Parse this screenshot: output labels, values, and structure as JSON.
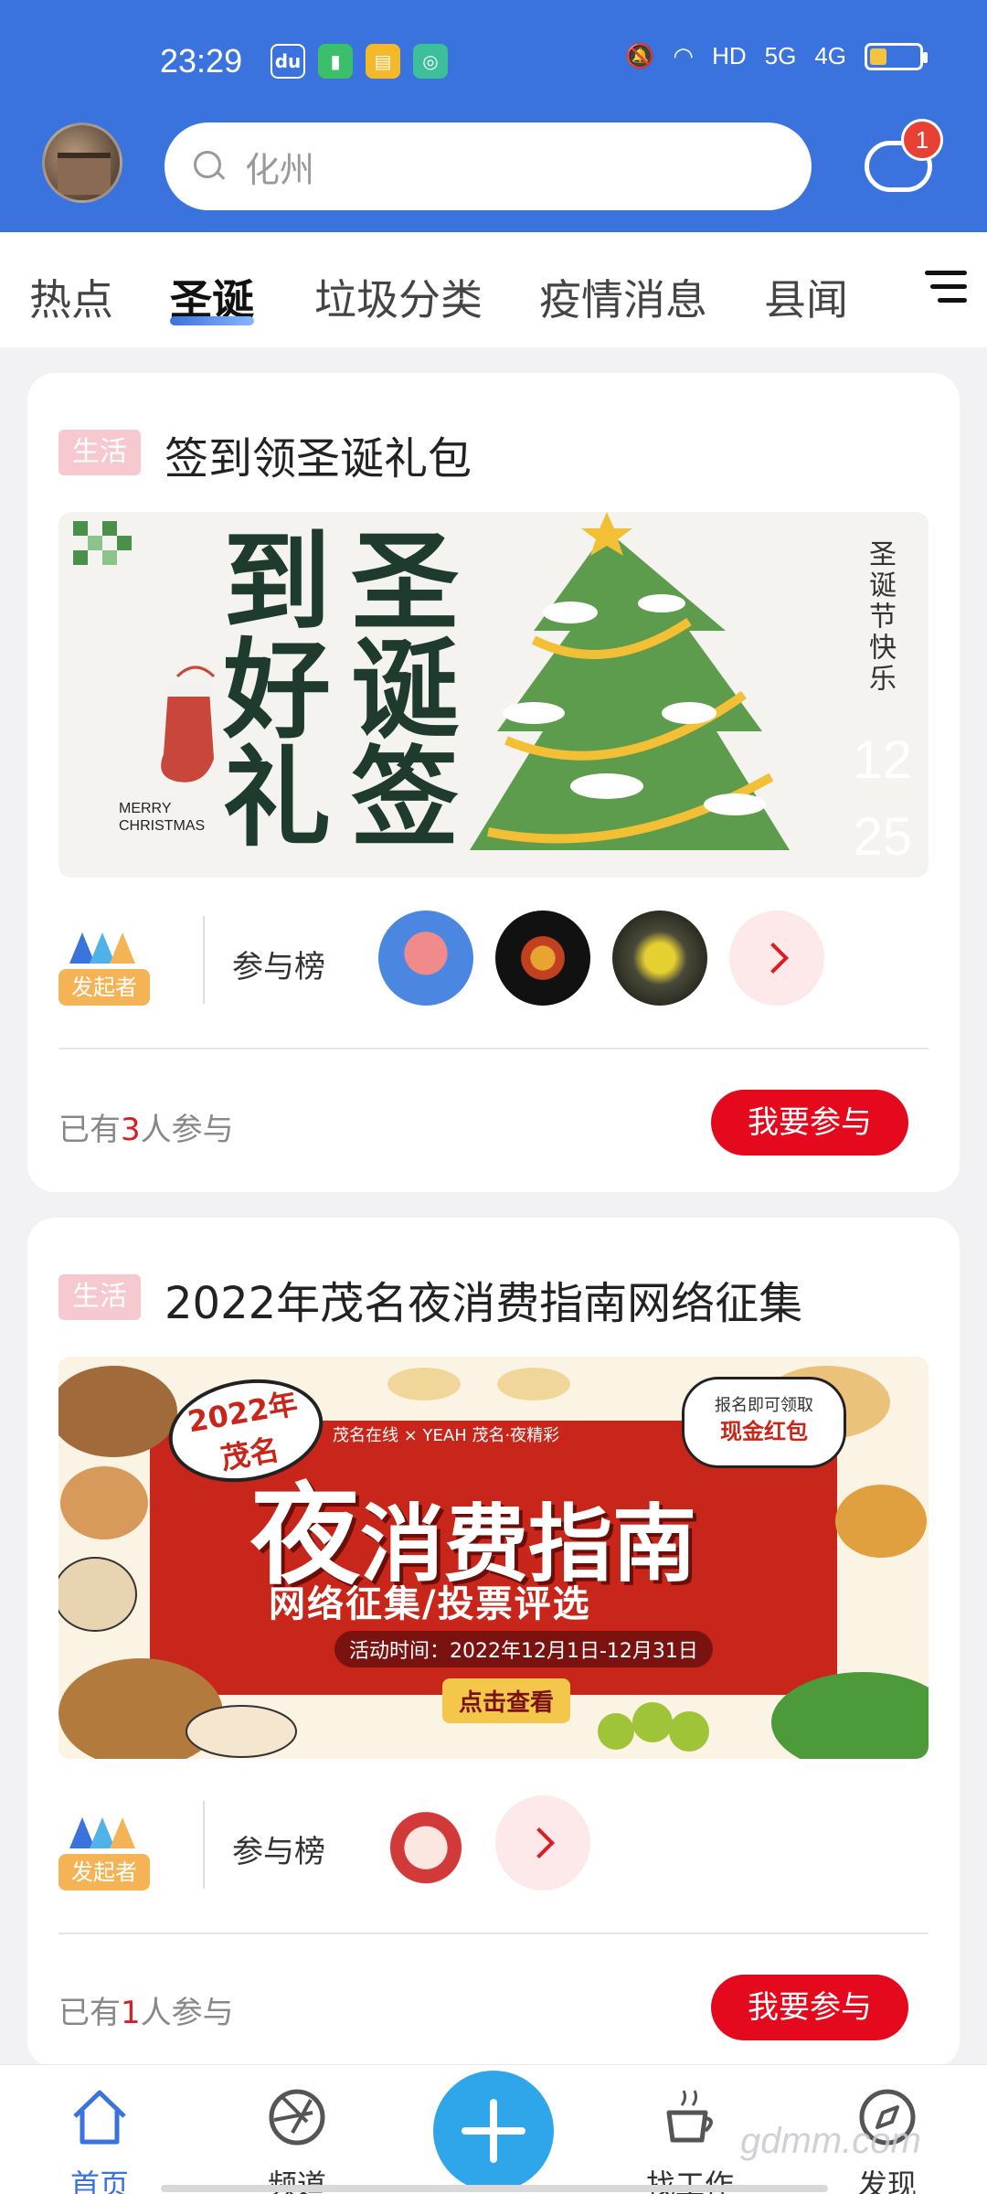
{
  "status_bar": {
    "time": "23:29",
    "network": "HD",
    "signal_5g": "5G",
    "signal_4g": "4G"
  },
  "header": {
    "search_placeholder": "化州",
    "message_badge": "1"
  },
  "tabs": {
    "items": [
      "热点",
      "圣诞",
      "垃圾分类",
      "疫情消息",
      "县闻"
    ],
    "active": "圣诞"
  },
  "card1": {
    "tag": "生活",
    "title": "签到领圣诞礼包",
    "banner": {
      "col1": [
        "到",
        "好",
        "礼"
      ],
      "col2": [
        "圣",
        "诞",
        "签"
      ],
      "side_text": "圣诞节快乐",
      "num1": "12",
      "num2": "25",
      "merry": "MERRY",
      "christmas": "CHRISTMAS"
    },
    "org_badge": "发起者",
    "rank_label": "参与榜",
    "count_prefix": "已有",
    "count_num": "3",
    "count_suffix": "人参与",
    "join_label": "我要参与"
  },
  "card2": {
    "tag": "生活",
    "title": "2022年茂名夜消费指南网络征集",
    "banner": {
      "year_line1": "2022年",
      "year_line2": "茂名",
      "brand": "茂名在线 × YEAH 茂名·夜精彩",
      "promo_line1": "报名即可领取",
      "promo_line2": "现金红包",
      "main_big": "夜",
      "main_rest": "消费指南",
      "sub": "网络征集/投票评选",
      "time": "活动时间：2022年12月1日-12月31日",
      "button": "点击查看"
    },
    "org_badge": "发起者",
    "rank_label": "参与榜",
    "count_prefix": "已有",
    "count_num": "1",
    "count_suffix": "人参与",
    "join_label": "我要参与"
  },
  "bottom_nav": {
    "home": "首页",
    "channel": "频道",
    "jobs": "找工作",
    "discover": "发现"
  },
  "watermark": "gdmm.com",
  "colors": {
    "header_blue": "#3a73dd",
    "join_red": "#e5091d",
    "plus_blue": "#2fa5ea",
    "tag_pink": "#f6c8cf",
    "badge_orange": "#f4b456"
  }
}
